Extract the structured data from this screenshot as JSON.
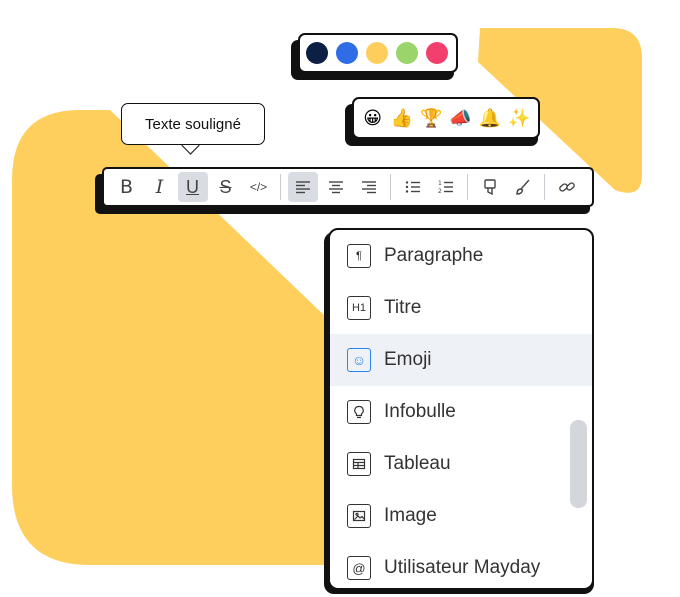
{
  "palette": {
    "colors": [
      "#0c1f45",
      "#2f6de6",
      "#ffcd5c",
      "#9cd46c",
      "#f23f6e"
    ]
  },
  "emoji_bar": {
    "emojis": [
      "😀",
      "👍",
      "🏆",
      "📣",
      "🔔",
      "✨"
    ]
  },
  "tooltip": {
    "text": "Texte souligné"
  },
  "toolbar": {
    "buttons": [
      {
        "name": "bold-icon",
        "glyph": "B"
      },
      {
        "name": "italic-icon",
        "glyph": "I"
      },
      {
        "name": "underline-icon",
        "glyph": "U"
      },
      {
        "name": "strikethrough-icon",
        "glyph": "S"
      },
      {
        "name": "code-icon",
        "glyph": "</>"
      },
      {
        "name": "align-left-icon"
      },
      {
        "name": "align-center-icon"
      },
      {
        "name": "align-right-icon"
      },
      {
        "name": "bullet-list-icon"
      },
      {
        "name": "numbered-list-icon"
      },
      {
        "name": "highlighter-icon"
      },
      {
        "name": "brush-icon"
      },
      {
        "name": "link-icon"
      }
    ],
    "active": [
      "underline-icon",
      "align-left-icon"
    ]
  },
  "menu": {
    "items": [
      {
        "icon": "paragraph-icon",
        "icon_glyph": "¶",
        "label": "Paragraphe"
      },
      {
        "icon": "heading-icon",
        "icon_glyph": "H1",
        "label": "Titre"
      },
      {
        "icon": "emoji-icon",
        "icon_glyph": "☺",
        "label": "Emoji"
      },
      {
        "icon": "lightbulb-icon",
        "icon_glyph": "💡",
        "label": "Infobulle"
      },
      {
        "icon": "table-icon",
        "icon_glyph": "▦",
        "label": "Tableau"
      },
      {
        "icon": "image-icon",
        "icon_glyph": "▨",
        "label": "Image"
      },
      {
        "icon": "at-icon",
        "icon_glyph": "@",
        "label": "Utilisateur Mayday"
      }
    ],
    "hovered": "Emoji"
  },
  "colors": {
    "accent_yellow": "#fecf5c",
    "hover_blue": "#2a86e8"
  }
}
